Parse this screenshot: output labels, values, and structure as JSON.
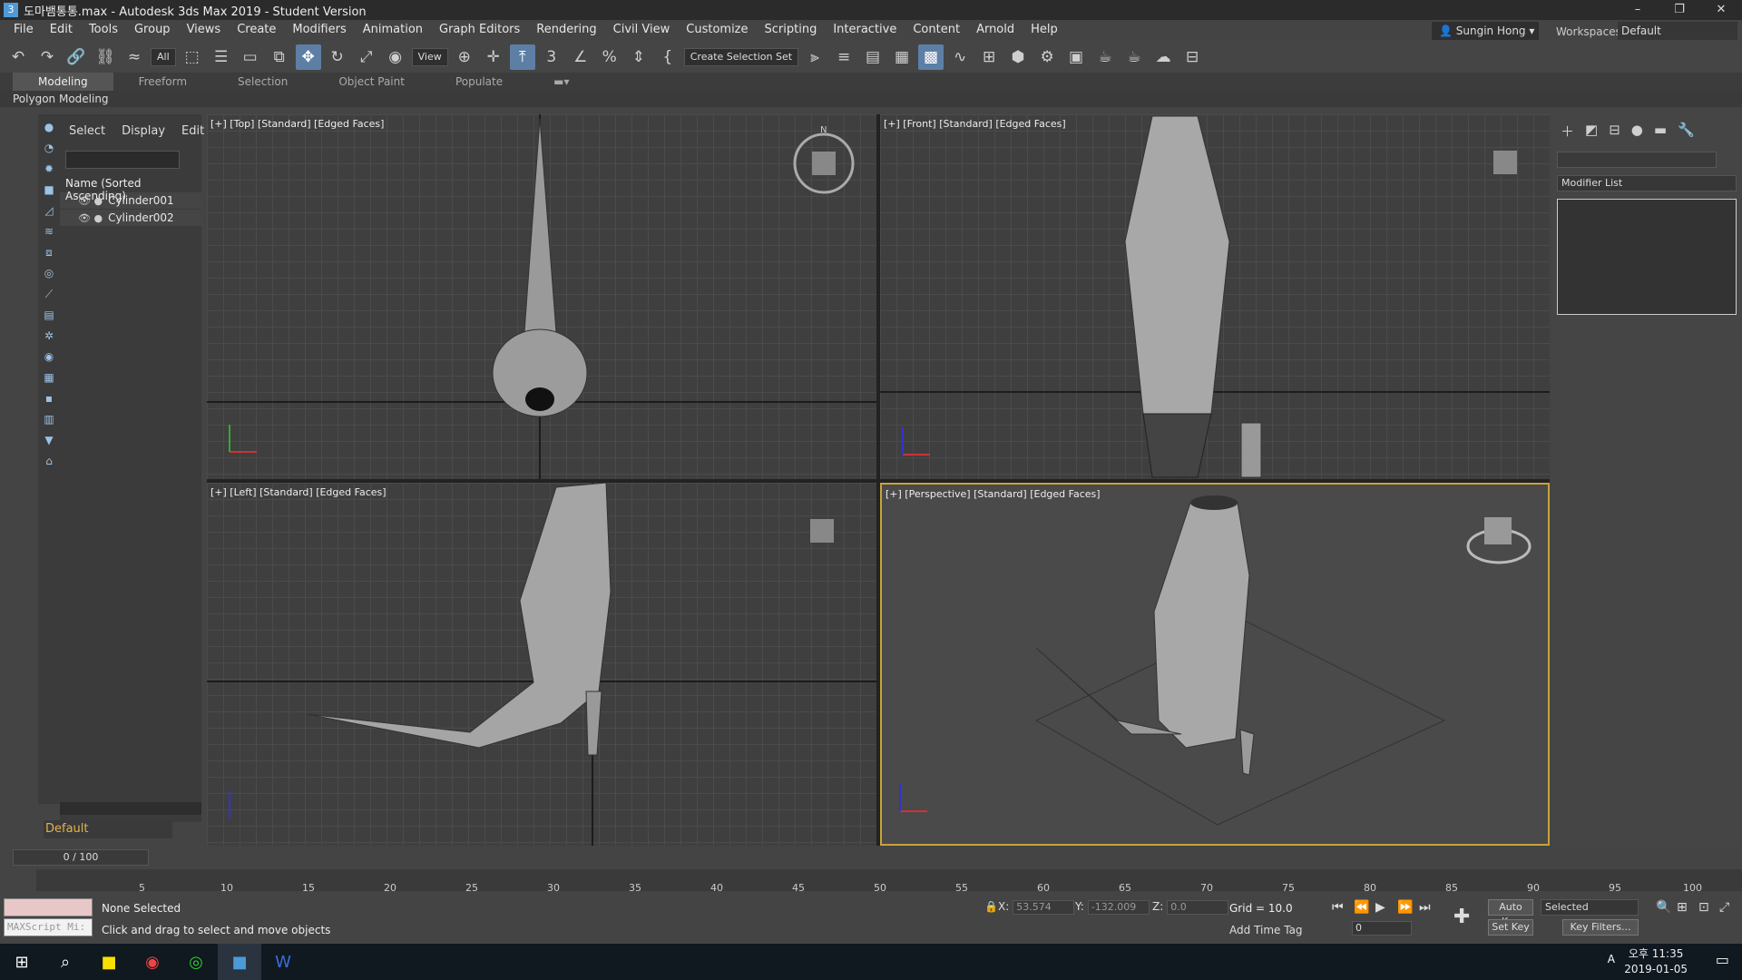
{
  "window": {
    "title": "도마뱀통통.max - Autodesk 3ds Max 2019 - Student Version"
  },
  "menus": [
    "File",
    "Edit",
    "Tools",
    "Group",
    "Views",
    "Create",
    "Modifiers",
    "Animation",
    "Graph Editors",
    "Rendering",
    "Civil View",
    "Customize",
    "Scripting",
    "Interactive",
    "Content",
    "Arnold",
    "Help"
  ],
  "user": "Sungin Hong",
  "workspace": {
    "label": "Workspaces:",
    "value": "Default"
  },
  "toolbar": {
    "filter": "All",
    "refcoord": "View",
    "selset": "Create Selection Set"
  },
  "ribbon": {
    "tabs": [
      "Modeling",
      "Freeform",
      "Selection",
      "Object Paint",
      "Populate"
    ],
    "active": "Modeling",
    "sub": "Polygon Modeling"
  },
  "explorer": {
    "tabs": [
      "Select",
      "Display",
      "Edit"
    ],
    "header": "Name (Sorted Ascending)",
    "items": [
      "Cylinder001",
      "Cylinder002"
    ],
    "layer": "Default"
  },
  "viewports": {
    "top": "[+] [Top] [Standard] [Edged Faces]",
    "front": "[+] [Front] [Standard] [Edged Faces]",
    "left": "[+] [Left] [Standard] [Edged Faces]",
    "persp": "[+] [Perspective] [Standard] [Edged Faces]"
  },
  "command_panel": {
    "modifier_list": "Modifier List"
  },
  "timeline": {
    "frame": "0 / 100",
    "ticks": [
      "5",
      "10",
      "15",
      "20",
      "25",
      "30",
      "35",
      "40",
      "45",
      "50",
      "55",
      "60",
      "65",
      "70",
      "75",
      "80",
      "85",
      "90",
      "95",
      "100"
    ]
  },
  "status": {
    "maxscript": "MAXScript Mi:",
    "selection": "None Selected",
    "prompt": "Click and drag to select and move objects",
    "x": "53.574",
    "y": "-132.009",
    "z": "0.0",
    "grid": "Grid = 10.0",
    "add_time_tag": "Add Time Tag",
    "auto_key": "Auto Key",
    "set_key": "Set Key",
    "selected": "Selected",
    "key_filters": "Key Filters...",
    "frame": "0"
  },
  "taskbar": {
    "time": "오후 11:35",
    "date": "2019-01-05",
    "ime": "A"
  }
}
